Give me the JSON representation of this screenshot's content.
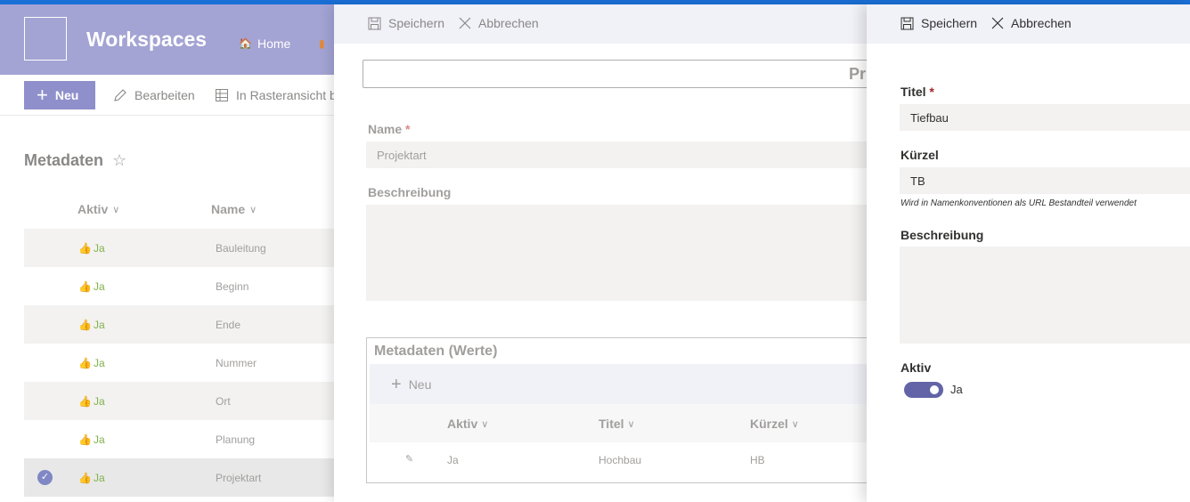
{
  "site": {
    "title": "Workspaces",
    "nav_home": "Home"
  },
  "commandbar": {
    "new_label": "Neu",
    "edit_label": "Bearbeiten",
    "grid_label": "In Rasteransicht b"
  },
  "list": {
    "title": "Metadaten",
    "columns": [
      "Aktiv",
      "Name"
    ],
    "rows": [
      {
        "aktiv": "Ja",
        "name": "Bauleitung",
        "selected": false
      },
      {
        "aktiv": "Ja",
        "name": "Beginn",
        "selected": false
      },
      {
        "aktiv": "Ja",
        "name": "Ende",
        "selected": false
      },
      {
        "aktiv": "Ja",
        "name": "Nummer",
        "selected": false
      },
      {
        "aktiv": "Ja",
        "name": "Ort",
        "selected": false
      },
      {
        "aktiv": "Ja",
        "name": "Planung",
        "selected": false
      },
      {
        "aktiv": "Ja",
        "name": "Projektart",
        "selected": true
      }
    ]
  },
  "panel1": {
    "save_label": "Speichern",
    "cancel_label": "Abbrechen",
    "title_fragment": "Pr",
    "name_label": "Name",
    "name_value": "Projektart",
    "description_label": "Beschreibung",
    "description_value": "",
    "meta_title": "Metadaten (Werte)",
    "meta_new_label": "Neu",
    "meta_columns": [
      "Aktiv",
      "Titel",
      "Kürzel"
    ],
    "meta_rows": [
      {
        "aktiv": "Ja",
        "titel": "Hochbau",
        "kuerzel": "HB"
      }
    ]
  },
  "panel2": {
    "save_label": "Speichern",
    "cancel_label": "Abbrechen",
    "titel_label": "Titel",
    "titel_value": "Tiefbau",
    "kuerzel_label": "Kürzel",
    "kuerzel_value": "TB",
    "kuerzel_hint": "Wird in Namenkonventionen als URL Bestandteil verwendet",
    "description_label": "Beschreibung",
    "description_value": "",
    "aktiv_label": "Aktiv",
    "aktiv_value": "Ja",
    "aktiv_on": true
  },
  "colors": {
    "accent": "#6264a7",
    "header_bg": "#a3a3d4",
    "topline": "#1a6fd6",
    "active_green": "#7fb24a"
  }
}
